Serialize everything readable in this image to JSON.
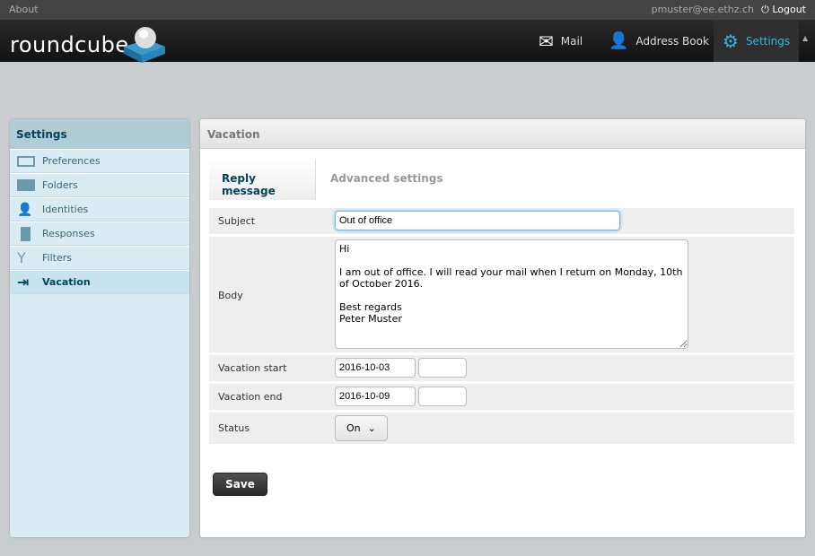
{
  "topbar": {
    "about": "About",
    "user": "pmuster@ee.ethz.ch",
    "logout": "Logout"
  },
  "header": {
    "logo": "roundcube",
    "nav": [
      {
        "label": "Mail",
        "icon": "envelope-icon"
      },
      {
        "label": "Address Book",
        "icon": "person-icon"
      },
      {
        "label": "Settings",
        "icon": "gear-icon"
      }
    ]
  },
  "sidebar": {
    "title": "Settings",
    "items": [
      {
        "label": "Preferences"
      },
      {
        "label": "Folders"
      },
      {
        "label": "Identities"
      },
      {
        "label": "Responses"
      },
      {
        "label": "Filters"
      },
      {
        "label": "Vacation",
        "selected": true
      }
    ]
  },
  "main": {
    "title": "Vacation",
    "tabs": [
      {
        "label": "Reply message"
      },
      {
        "label": "Advanced settings"
      }
    ],
    "form": {
      "subject_label": "Subject",
      "subject": "Out of office",
      "body_label": "Body",
      "body": "Hi\n\nI am out of office. I will read your mail when I return on Monday, 10th of October 2016.\n\nBest regards\nPeter Muster",
      "start_label": "Vacation start",
      "start_date": "2016-10-03",
      "start_time": "",
      "end_label": "Vacation end",
      "end_date": "2016-10-09",
      "end_time": "",
      "status_label": "Status",
      "status": "On"
    },
    "save": "Save"
  },
  "colors": {
    "accent": "#30b5e8",
    "sidebar": "#d9ecf4"
  }
}
